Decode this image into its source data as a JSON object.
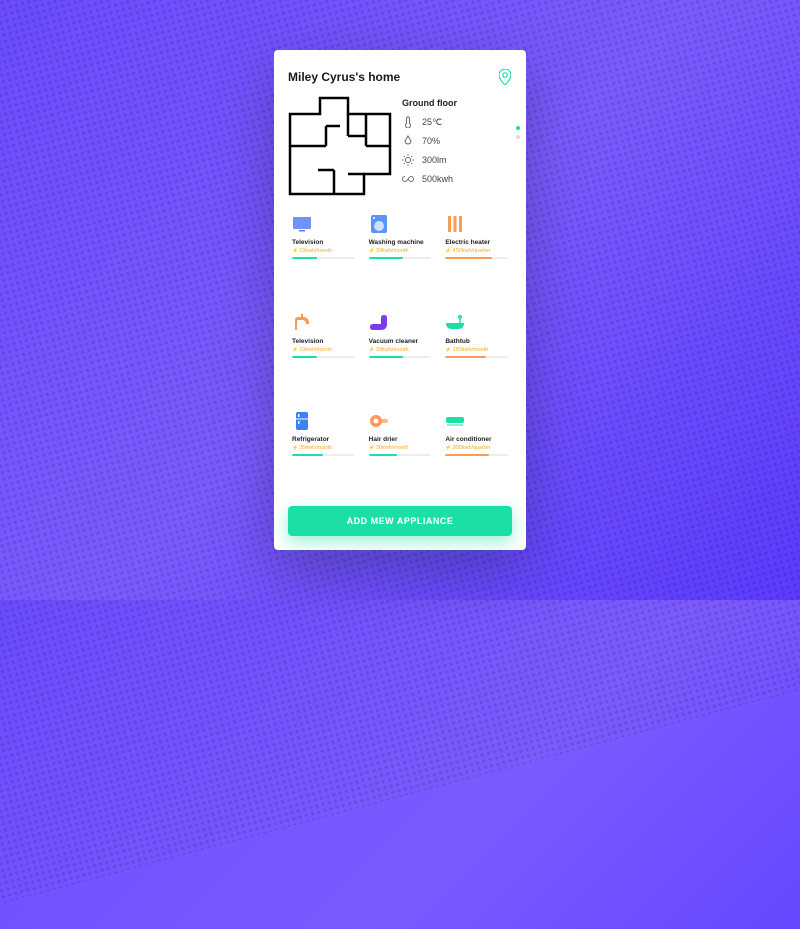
{
  "header": {
    "title": "Miley Cyrus's home"
  },
  "floor": {
    "name": "Ground floor",
    "temperature": "25℃",
    "humidity": "70%",
    "light": "300lm",
    "power": "500kwh"
  },
  "appliances": [
    {
      "name": "Television",
      "usage": "19kwh/month",
      "barColor": "#1be0a5",
      "barPct": 40,
      "iconColor": "#5b7fff"
    },
    {
      "name": "Washing machine",
      "usage": "30kwh/month",
      "barColor": "#1be0a5",
      "barPct": 55,
      "iconColor": "#3b82f6"
    },
    {
      "name": "Electric heater",
      "usage": "450kwh/quarter",
      "barColor": "#ff9a56",
      "barPct": 75,
      "iconColor": "#ff9a56"
    },
    {
      "name": "Television",
      "usage": "19kwh/month",
      "barColor": "#1be0a5",
      "barPct": 40,
      "iconColor": "#ff9a56"
    },
    {
      "name": "Vacuum cleaner",
      "usage": "30kwh/month",
      "barColor": "#1be0a5",
      "barPct": 55,
      "iconColor": "#7c3aed"
    },
    {
      "name": "Bathtub",
      "usage": "150kwh/month",
      "barColor": "#ff9a56",
      "barPct": 65,
      "iconColor": "#1be0a5"
    },
    {
      "name": "Refrigerator",
      "usage": "35kwh/month",
      "barColor": "#1be0a5",
      "barPct": 50,
      "iconColor": "#3b82f6"
    },
    {
      "name": "Hair drier",
      "usage": "30kwh/month",
      "barColor": "#1be0a5",
      "barPct": 45,
      "iconColor": "#ff9a56"
    },
    {
      "name": "Air conditioner",
      "usage": "300kwh/quarter",
      "barColor": "#ff9a56",
      "barPct": 70,
      "iconColor": "#1be0a5"
    }
  ],
  "cta": {
    "label": "ADD MEW APPLIANCE"
  }
}
